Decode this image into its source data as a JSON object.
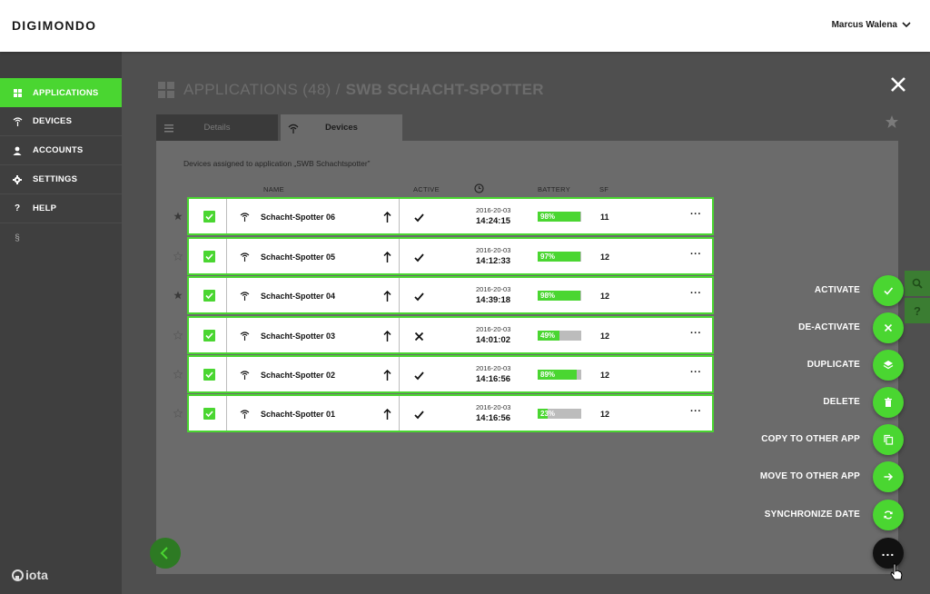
{
  "header": {
    "brand": "DIGIMONDO",
    "user_name": "Marcus Walena"
  },
  "sidebar": {
    "items": [
      {
        "label": "APPLICATIONS",
        "icon": "grid-icon",
        "active": true
      },
      {
        "label": "DEVICES",
        "icon": "antenna-icon",
        "active": false
      },
      {
        "label": "ACCOUNTS",
        "icon": "person-icon",
        "active": false
      },
      {
        "label": "SETTINGS",
        "icon": "gear-icon",
        "active": false
      },
      {
        "label": "HELP",
        "icon": "question-icon",
        "active": false
      },
      {
        "label": "",
        "icon": "paragraph-icon",
        "active": false
      }
    ],
    "footer_logo": "iota"
  },
  "page": {
    "title_prefix": "APPLICATIONS (48) /",
    "title_main": "SWB SCHACHT-SPOTTER",
    "tabs": [
      {
        "label": "Details"
      },
      {
        "label": "Devices"
      }
    ],
    "assigned_text": "Devices assigned to application „SWB Schachtspotter”"
  },
  "table": {
    "headers": {
      "name": "NAME",
      "active": "ACTIVE",
      "battery": "BATTERY",
      "sf": "SF"
    },
    "rows": [
      {
        "name": "Schacht-Spotter 06",
        "active": true,
        "date": "2016-20-03",
        "time": "14:24:15",
        "battery": "98%",
        "battery_level": 0.98,
        "sf": "11",
        "starred": true
      },
      {
        "name": "Schacht-Spotter 05",
        "active": true,
        "date": "2016-20-03",
        "time": "14:12:33",
        "battery": "97%",
        "battery_level": 0.97,
        "sf": "12",
        "starred": false
      },
      {
        "name": "Schacht-Spotter 04",
        "active": true,
        "date": "2016-20-03",
        "time": "14:39:18",
        "battery": "98%",
        "battery_level": 0.98,
        "sf": "12",
        "starred": true
      },
      {
        "name": "Schacht-Spotter 03",
        "active": false,
        "date": "2016-20-03",
        "time": "14:01:02",
        "battery": "49%",
        "battery_level": 0.49,
        "sf": "12",
        "starred": false
      },
      {
        "name": "Schacht-Spotter 02",
        "active": true,
        "date": "2016-20-03",
        "time": "14:16:56",
        "battery": "89%",
        "battery_level": 0.89,
        "sf": "12",
        "starred": false
      },
      {
        "name": "Schacht-Spotter 01",
        "active": true,
        "date": "2016-20-03",
        "time": "14:16:56",
        "battery": "23%",
        "battery_level": 0.23,
        "sf": "12",
        "starred": false
      }
    ]
  },
  "actions": [
    {
      "label": "ACTIVATE",
      "icon": "check-icon"
    },
    {
      "label": "DE-ACTIVATE",
      "icon": "close-icon"
    },
    {
      "label": "DUPLICATE",
      "icon": "layers-icon"
    },
    {
      "label": "DELETE",
      "icon": "trash-icon"
    },
    {
      "label": "COPY TO OTHER APP",
      "icon": "copy-icon"
    },
    {
      "label": "MOVE TO OTHER APP",
      "icon": "arrow-right-icon"
    },
    {
      "label": "SYNCHRONIZE DATE",
      "icon": "sync-icon"
    }
  ],
  "colors": {
    "accent": "#4ad631",
    "sidebar": "#3f3f3f",
    "panel": "#6b6b6b"
  }
}
